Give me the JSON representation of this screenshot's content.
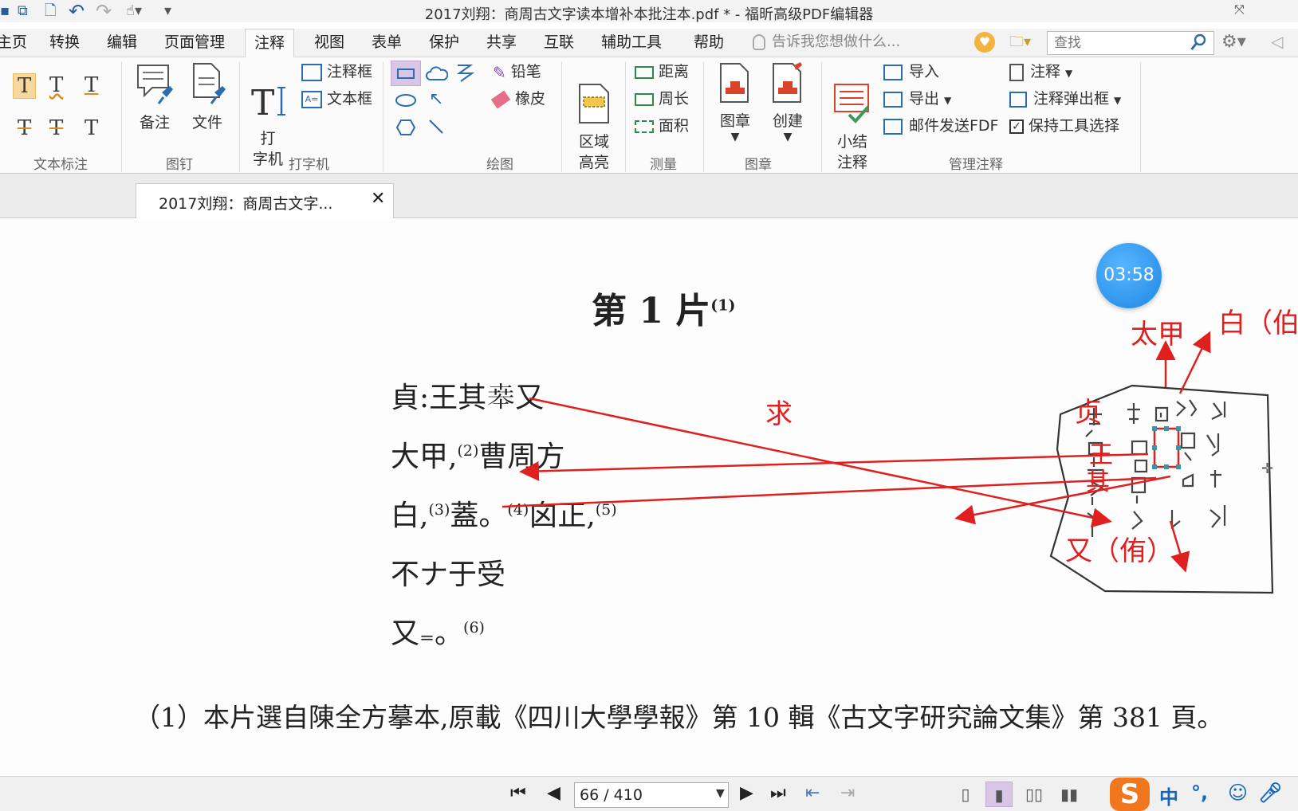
{
  "window": {
    "title": "2017刘翔：商周古文字读本增补本批注本.pdf * - 福昕高级PDF编辑器"
  },
  "menu": {
    "tabs": [
      "主页",
      "转换",
      "编辑",
      "页面管理",
      "注释",
      "视图",
      "表单",
      "保护",
      "共享",
      "互联",
      "辅助工具",
      "帮助"
    ],
    "active": "注释",
    "tell_me": "告诉我您想做什么...",
    "search_placeholder": "查找"
  },
  "ribbon": {
    "groups": {
      "text_markup": "文本标注",
      "pin": "图钉",
      "typewriter": "打字机",
      "drawing": "绘图",
      "measure": "测量",
      "stamp": "图章",
      "manage": "管理注释"
    },
    "pin": {
      "note": "备注",
      "file": "文件"
    },
    "typewriter": {
      "typewriter": "打\n字机",
      "callout": "注释框",
      "textbox": "文本框"
    },
    "drawing": {
      "pencil": "铅笔",
      "eraser": "橡皮",
      "area_highlight": "区域\n高亮"
    },
    "measure": {
      "distance": "距离",
      "perimeter": "周长",
      "area": "面积"
    },
    "stamp": {
      "stamp": "图章",
      "create": "创建"
    },
    "manage": {
      "summarize": "小结\n注释",
      "import": "导入",
      "export": "导出",
      "email_fdf": "邮件发送FDF",
      "comments": "注释",
      "popup": "注释弹出框",
      "keep_tool": "保持工具选择"
    }
  },
  "doc_tab": {
    "label": "2017刘翔：商周古文字..."
  },
  "document": {
    "heading": "第 1 片",
    "heading_sup": "(1)",
    "lines": [
      {
        "text": "貞:王其",
        "rest": "又"
      },
      {
        "text": "大甲,",
        "sup": "(2)",
        "rest": "曹周方"
      },
      {
        "text": "白,",
        "sup": "(3)",
        "mid": "蓋。",
        "sup2": "(4)",
        "rest": "囟正,",
        "sup3": "(5)"
      },
      {
        "text": "不ナ于受"
      },
      {
        "text": "又",
        "mid": "₌。",
        "sup": "(6)"
      }
    ],
    "special_char": "𠦪",
    "footnote": "（1）本片選自陳全方摹本,原載《四川大學學報》第 10 輯《古文字研究論文集》第 381 頁。"
  },
  "annotations": {
    "qiu": "求",
    "taijia": "太甲",
    "bai": "白（伯",
    "zhen": "贞",
    "wang": "王",
    "qi": "其",
    "you": "又（侑）",
    "color": "#e0201f"
  },
  "timer": "03:58",
  "status": {
    "page": "66 / 410"
  },
  "ime": {
    "lang": "中",
    "punct": "°,"
  }
}
